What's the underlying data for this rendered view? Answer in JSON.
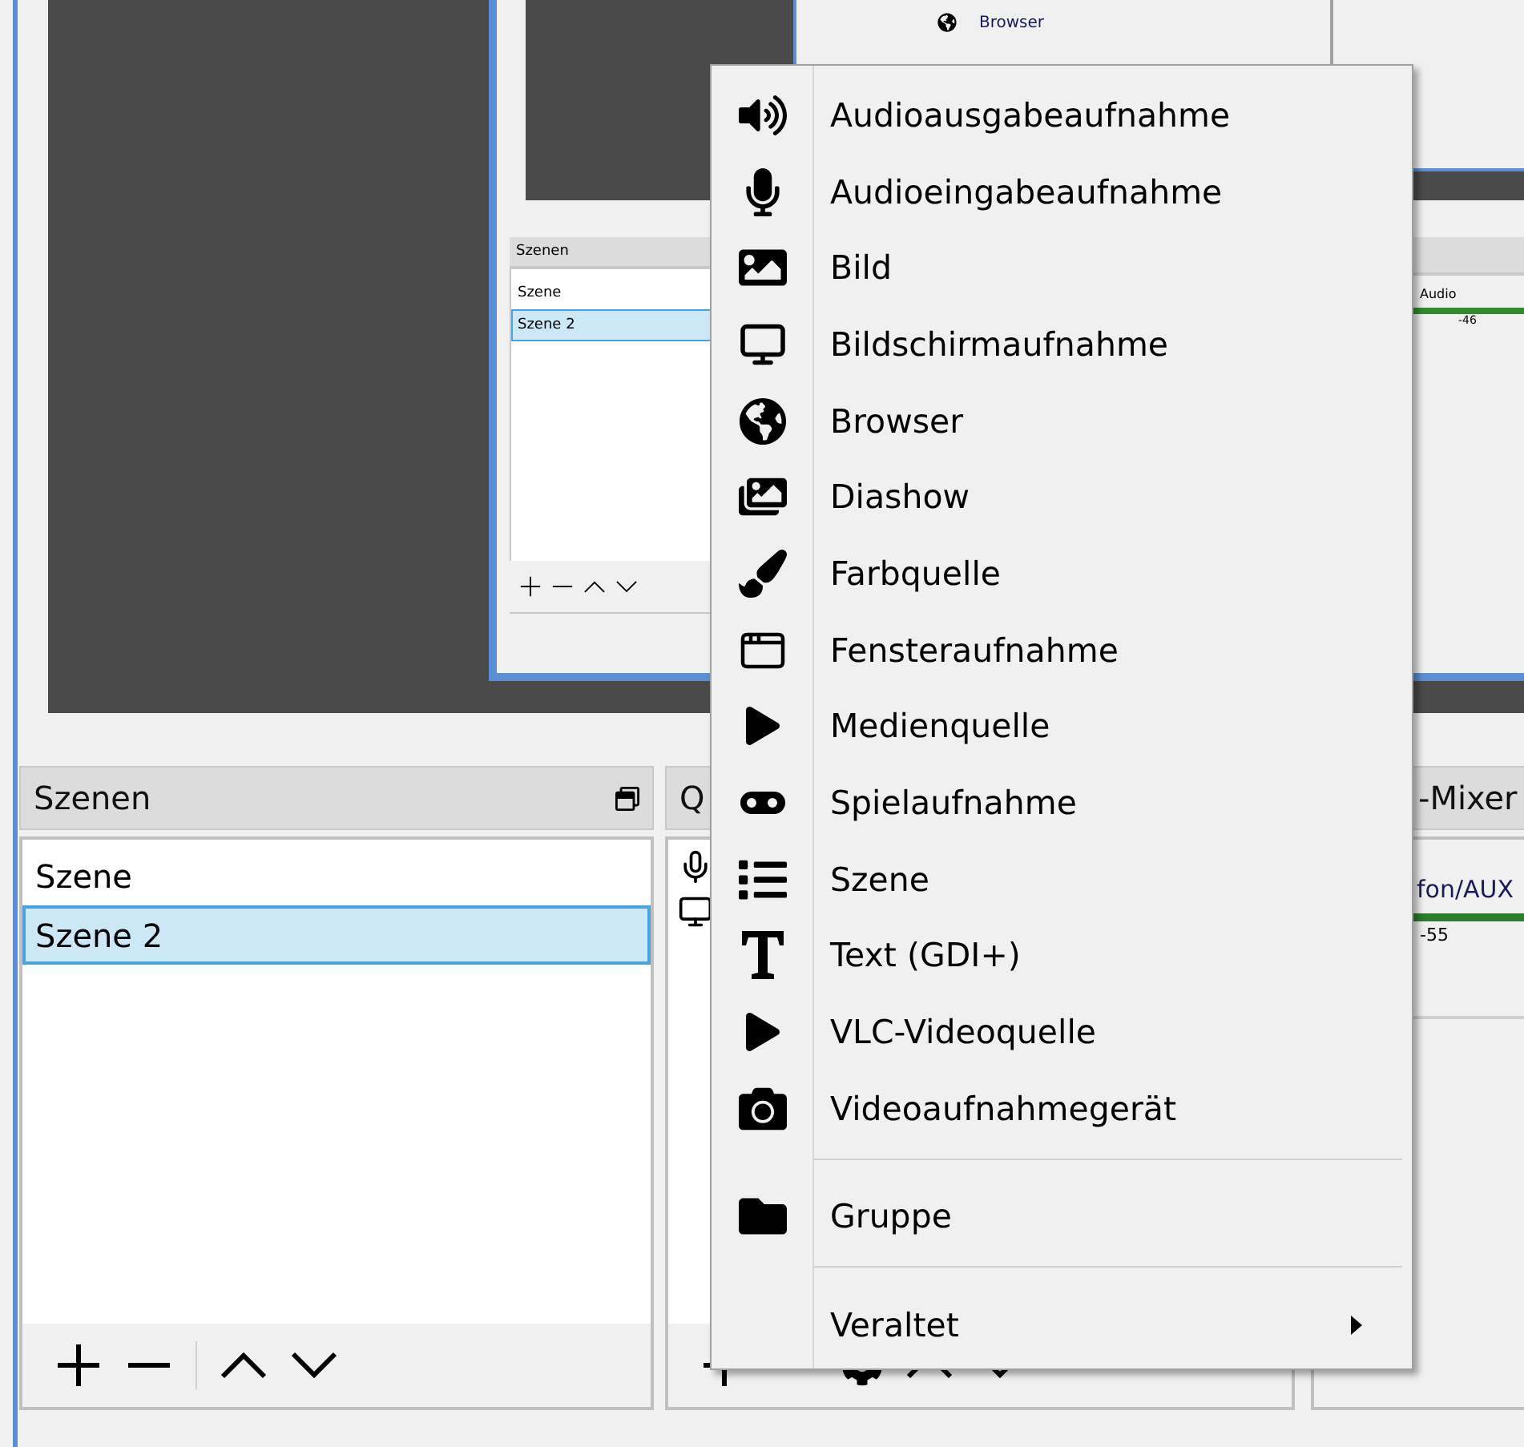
{
  "preview": {
    "nested_window": {
      "sources": [
        {
          "name": "Browser"
        }
      ],
      "scenes_dock": {
        "title": "Szenen",
        "scenes": [
          {
            "name": "Szene",
            "selected": false
          },
          {
            "name": "Szene 2",
            "selected": true
          }
        ]
      },
      "mixer_dock": {
        "channel": "Audio",
        "tick": "-46"
      }
    }
  },
  "docks": {
    "scenes": {
      "title": "Szenen",
      "items": [
        {
          "name": "Szene",
          "selected": false
        },
        {
          "name": "Szene 2",
          "selected": true
        }
      ]
    },
    "sources": {
      "title": "Q"
    },
    "mixer": {
      "title": "-Mixer",
      "channel": "fon/AUX",
      "tick": "-55"
    }
  },
  "context_menu": {
    "groups": [
      [
        {
          "label": "Audioausgabeaufnahme",
          "submenu": false
        },
        {
          "label": "Audioeingabeaufnahme",
          "submenu": false
        },
        {
          "label": "Bild",
          "submenu": false
        },
        {
          "label": "Bildschirmaufnahme",
          "submenu": false
        },
        {
          "label": "Browser",
          "submenu": false
        },
        {
          "label": "Diashow",
          "submenu": false
        },
        {
          "label": "Farbquelle",
          "submenu": false
        },
        {
          "label": "Fensteraufnahme",
          "submenu": false
        },
        {
          "label": "Medienquelle",
          "submenu": false
        },
        {
          "label": "Spielaufnahme",
          "submenu": false
        },
        {
          "label": "Szene",
          "submenu": false
        },
        {
          "label": "Text (GDI+)",
          "submenu": false
        },
        {
          "label": "VLC-Videoquelle",
          "submenu": false
        },
        {
          "label": "Videoaufnahmegerät",
          "submenu": false
        }
      ],
      [
        {
          "label": "Gruppe",
          "submenu": false
        }
      ],
      [
        {
          "label": "Veraltet",
          "submenu": true
        }
      ]
    ]
  }
}
